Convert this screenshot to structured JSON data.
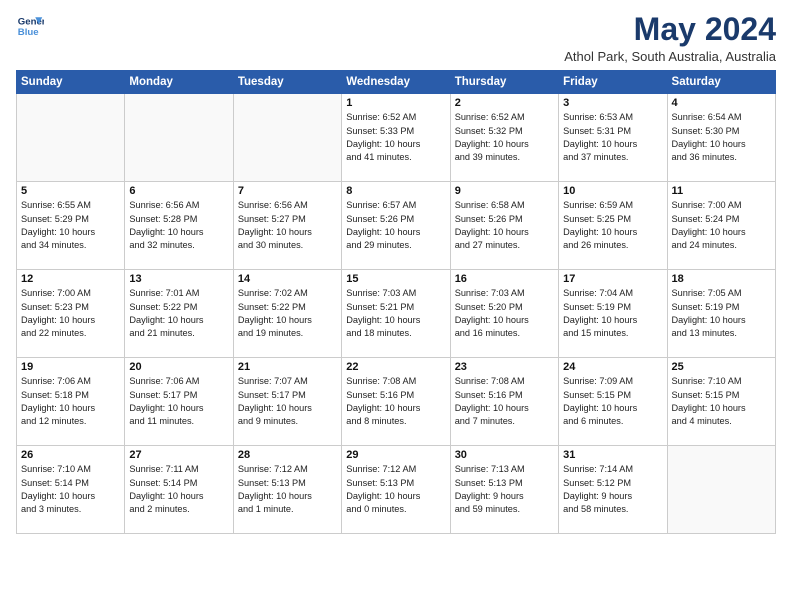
{
  "header": {
    "logo_line1": "General",
    "logo_line2": "Blue",
    "month": "May 2024",
    "location": "Athol Park, South Australia, Australia"
  },
  "days_of_week": [
    "Sunday",
    "Monday",
    "Tuesday",
    "Wednesday",
    "Thursday",
    "Friday",
    "Saturday"
  ],
  "weeks": [
    [
      {
        "day": "",
        "info": ""
      },
      {
        "day": "",
        "info": ""
      },
      {
        "day": "",
        "info": ""
      },
      {
        "day": "1",
        "info": "Sunrise: 6:52 AM\nSunset: 5:33 PM\nDaylight: 10 hours\nand 41 minutes."
      },
      {
        "day": "2",
        "info": "Sunrise: 6:52 AM\nSunset: 5:32 PM\nDaylight: 10 hours\nand 39 minutes."
      },
      {
        "day": "3",
        "info": "Sunrise: 6:53 AM\nSunset: 5:31 PM\nDaylight: 10 hours\nand 37 minutes."
      },
      {
        "day": "4",
        "info": "Sunrise: 6:54 AM\nSunset: 5:30 PM\nDaylight: 10 hours\nand 36 minutes."
      }
    ],
    [
      {
        "day": "5",
        "info": "Sunrise: 6:55 AM\nSunset: 5:29 PM\nDaylight: 10 hours\nand 34 minutes."
      },
      {
        "day": "6",
        "info": "Sunrise: 6:56 AM\nSunset: 5:28 PM\nDaylight: 10 hours\nand 32 minutes."
      },
      {
        "day": "7",
        "info": "Sunrise: 6:56 AM\nSunset: 5:27 PM\nDaylight: 10 hours\nand 30 minutes."
      },
      {
        "day": "8",
        "info": "Sunrise: 6:57 AM\nSunset: 5:26 PM\nDaylight: 10 hours\nand 29 minutes."
      },
      {
        "day": "9",
        "info": "Sunrise: 6:58 AM\nSunset: 5:26 PM\nDaylight: 10 hours\nand 27 minutes."
      },
      {
        "day": "10",
        "info": "Sunrise: 6:59 AM\nSunset: 5:25 PM\nDaylight: 10 hours\nand 26 minutes."
      },
      {
        "day": "11",
        "info": "Sunrise: 7:00 AM\nSunset: 5:24 PM\nDaylight: 10 hours\nand 24 minutes."
      }
    ],
    [
      {
        "day": "12",
        "info": "Sunrise: 7:00 AM\nSunset: 5:23 PM\nDaylight: 10 hours\nand 22 minutes."
      },
      {
        "day": "13",
        "info": "Sunrise: 7:01 AM\nSunset: 5:22 PM\nDaylight: 10 hours\nand 21 minutes."
      },
      {
        "day": "14",
        "info": "Sunrise: 7:02 AM\nSunset: 5:22 PM\nDaylight: 10 hours\nand 19 minutes."
      },
      {
        "day": "15",
        "info": "Sunrise: 7:03 AM\nSunset: 5:21 PM\nDaylight: 10 hours\nand 18 minutes."
      },
      {
        "day": "16",
        "info": "Sunrise: 7:03 AM\nSunset: 5:20 PM\nDaylight: 10 hours\nand 16 minutes."
      },
      {
        "day": "17",
        "info": "Sunrise: 7:04 AM\nSunset: 5:19 PM\nDaylight: 10 hours\nand 15 minutes."
      },
      {
        "day": "18",
        "info": "Sunrise: 7:05 AM\nSunset: 5:19 PM\nDaylight: 10 hours\nand 13 minutes."
      }
    ],
    [
      {
        "day": "19",
        "info": "Sunrise: 7:06 AM\nSunset: 5:18 PM\nDaylight: 10 hours\nand 12 minutes."
      },
      {
        "day": "20",
        "info": "Sunrise: 7:06 AM\nSunset: 5:17 PM\nDaylight: 10 hours\nand 11 minutes."
      },
      {
        "day": "21",
        "info": "Sunrise: 7:07 AM\nSunset: 5:17 PM\nDaylight: 10 hours\nand 9 minutes."
      },
      {
        "day": "22",
        "info": "Sunrise: 7:08 AM\nSunset: 5:16 PM\nDaylight: 10 hours\nand 8 minutes."
      },
      {
        "day": "23",
        "info": "Sunrise: 7:08 AM\nSunset: 5:16 PM\nDaylight: 10 hours\nand 7 minutes."
      },
      {
        "day": "24",
        "info": "Sunrise: 7:09 AM\nSunset: 5:15 PM\nDaylight: 10 hours\nand 6 minutes."
      },
      {
        "day": "25",
        "info": "Sunrise: 7:10 AM\nSunset: 5:15 PM\nDaylight: 10 hours\nand 4 minutes."
      }
    ],
    [
      {
        "day": "26",
        "info": "Sunrise: 7:10 AM\nSunset: 5:14 PM\nDaylight: 10 hours\nand 3 minutes."
      },
      {
        "day": "27",
        "info": "Sunrise: 7:11 AM\nSunset: 5:14 PM\nDaylight: 10 hours\nand 2 minutes."
      },
      {
        "day": "28",
        "info": "Sunrise: 7:12 AM\nSunset: 5:13 PM\nDaylight: 10 hours\nand 1 minute."
      },
      {
        "day": "29",
        "info": "Sunrise: 7:12 AM\nSunset: 5:13 PM\nDaylight: 10 hours\nand 0 minutes."
      },
      {
        "day": "30",
        "info": "Sunrise: 7:13 AM\nSunset: 5:13 PM\nDaylight: 9 hours\nand 59 minutes."
      },
      {
        "day": "31",
        "info": "Sunrise: 7:14 AM\nSunset: 5:12 PM\nDaylight: 9 hours\nand 58 minutes."
      },
      {
        "day": "",
        "info": ""
      }
    ]
  ]
}
